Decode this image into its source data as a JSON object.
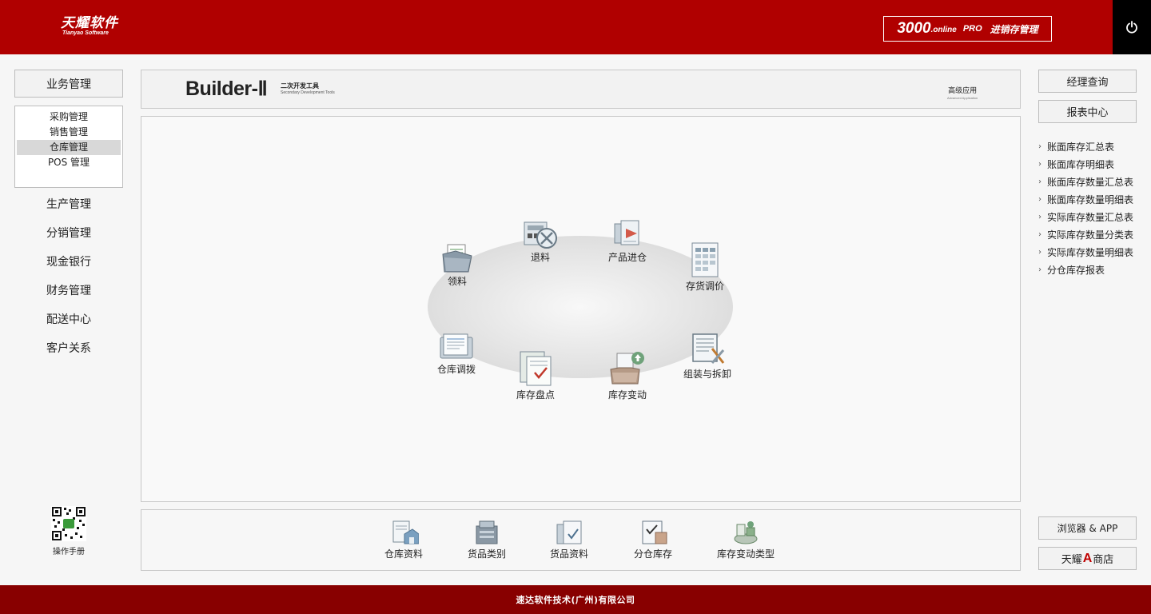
{
  "header": {
    "logo_cn": "天耀软件",
    "logo_en": "Tianyao Software",
    "product_num": "3000",
    "product_online": ".online",
    "product_pro": "PRO",
    "product_name": "进销存管理"
  },
  "sidebar": {
    "section_title": "业务管理",
    "submenu": [
      "采购管理",
      "销售管理",
      "仓库管理",
      "POS 管理"
    ],
    "active_submenu": "仓库管理",
    "menu": [
      "生产管理",
      "分销管理",
      "现金银行",
      "财务管理",
      "配送中心",
      "客户关系"
    ],
    "manual_label": "操作手册"
  },
  "builder": {
    "title": "Builder-Ⅱ",
    "sub_cn": "二次开发工具",
    "sub_en": "Secondary Development Tools",
    "advanced_cn": "高级应用",
    "advanced_en": "Advanced Application"
  },
  "workflow": {
    "nodes": [
      "领料",
      "退料",
      "产品进仓",
      "存货调价",
      "仓库调拨",
      "库存盘点",
      "库存变动",
      "组装与拆卸"
    ]
  },
  "bottom": {
    "items": [
      "仓库资料",
      "货品类别",
      "货品资料",
      "分仓库存",
      "库存变动类型"
    ]
  },
  "right": {
    "manager_query": "经理查询",
    "report_center": "报表中心",
    "reports": [
      "账面库存汇总表",
      "账面库存明细表",
      "账面库存数量汇总表",
      "账面库存数量明细表",
      "实际库存数量汇总表",
      "实际库存数量分类表",
      "实际库存数量明细表",
      "分仓库存报表"
    ],
    "browser_app": "浏览器 & APP",
    "store_pre": "天耀",
    "store_mark": "A",
    "store_post": "商店"
  },
  "footer": {
    "company": "速达软件技术(广州)有限公司"
  },
  "colors": {
    "header_red": "#b00000",
    "footer_red": "#880000"
  }
}
